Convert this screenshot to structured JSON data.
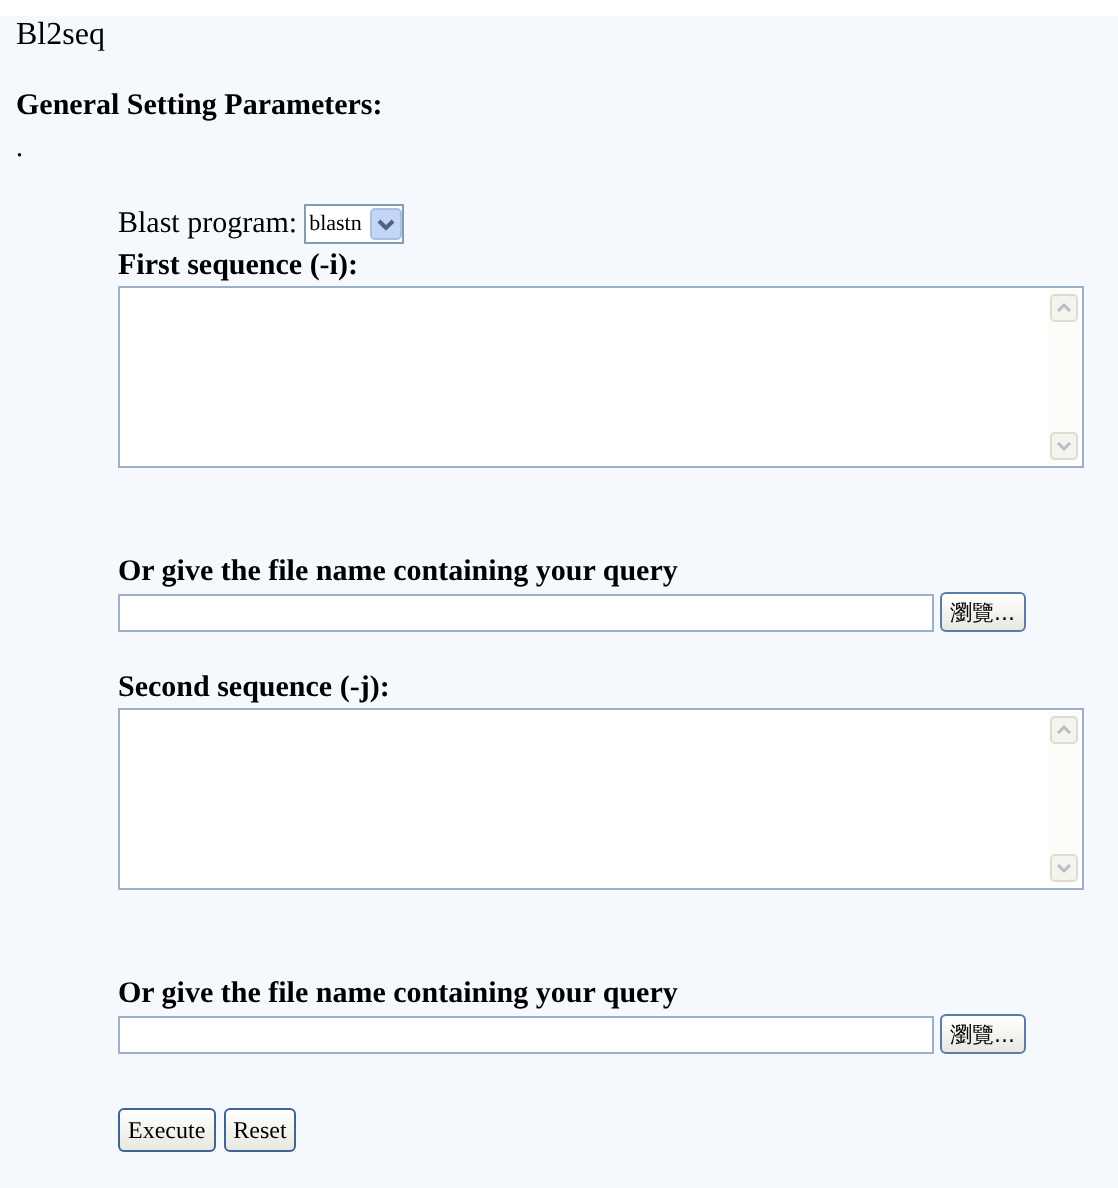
{
  "title": "Bl2seq",
  "section_heading": "General Setting Parameters:",
  "separator_text": ".",
  "blast_program": {
    "label": "Blast program:",
    "value": "blastn"
  },
  "sequences": [
    {
      "label": "First sequence (-i):",
      "file_label": "Or give the file name containing your query",
      "browse_button": "瀏覽..."
    },
    {
      "label": "Second sequence (-j):",
      "file_label": "Or give the file name containing your query",
      "browse_button": "瀏覽..."
    }
  ],
  "buttons": [
    "Execute",
    "Reset"
  ]
}
